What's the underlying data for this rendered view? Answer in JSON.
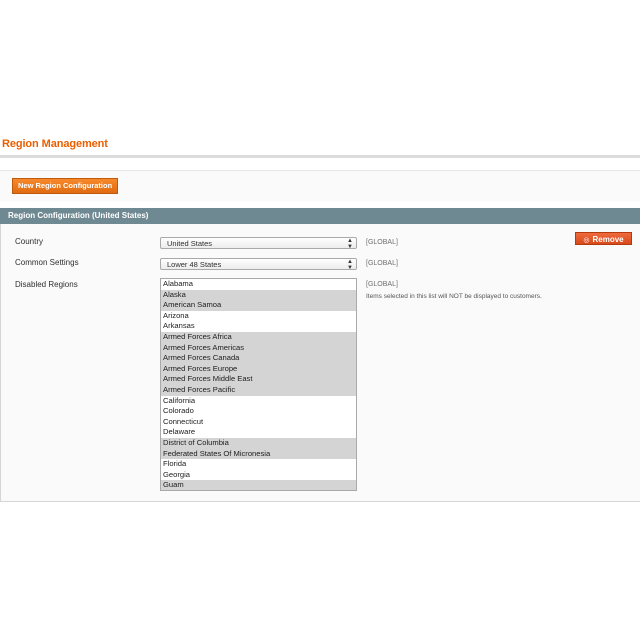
{
  "page": {
    "title": "Region Management",
    "new_button_label": "New Region Configuration"
  },
  "section": {
    "header": "Region Configuration (United States)",
    "remove_label": "Remove",
    "remove_icon": "remove-circle-icon"
  },
  "fields": {
    "country": {
      "label": "Country",
      "value": "United States",
      "scope": "[GLOBAL]"
    },
    "common_settings": {
      "label": "Common Settings",
      "value": "Lower 48 States",
      "scope": "[GLOBAL]"
    },
    "disabled_regions": {
      "label": "Disabled Regions",
      "scope": "[GLOBAL]",
      "hint": "Items selected in this list will NOT be displayed to customers.",
      "items": [
        {
          "name": "Alabama",
          "selected": false
        },
        {
          "name": "Alaska",
          "selected": true
        },
        {
          "name": "American Samoa",
          "selected": true
        },
        {
          "name": "Arizona",
          "selected": false
        },
        {
          "name": "Arkansas",
          "selected": false
        },
        {
          "name": "Armed Forces Africa",
          "selected": true
        },
        {
          "name": "Armed Forces Americas",
          "selected": true
        },
        {
          "name": "Armed Forces Canada",
          "selected": true
        },
        {
          "name": "Armed Forces Europe",
          "selected": true
        },
        {
          "name": "Armed Forces Middle East",
          "selected": true
        },
        {
          "name": "Armed Forces Pacific",
          "selected": true
        },
        {
          "name": "California",
          "selected": false
        },
        {
          "name": "Colorado",
          "selected": false
        },
        {
          "name": "Connecticut",
          "selected": false
        },
        {
          "name": "Delaware",
          "selected": false
        },
        {
          "name": "District of Columbia",
          "selected": true
        },
        {
          "name": "Federated States Of Micronesia",
          "selected": true
        },
        {
          "name": "Florida",
          "selected": false
        },
        {
          "name": "Georgia",
          "selected": false
        },
        {
          "name": "Guam",
          "selected": true
        }
      ]
    }
  },
  "colors": {
    "title_orange": "#eb5e00",
    "header_slate": "#6f8992",
    "selected_gray": "#d4d4d4"
  }
}
